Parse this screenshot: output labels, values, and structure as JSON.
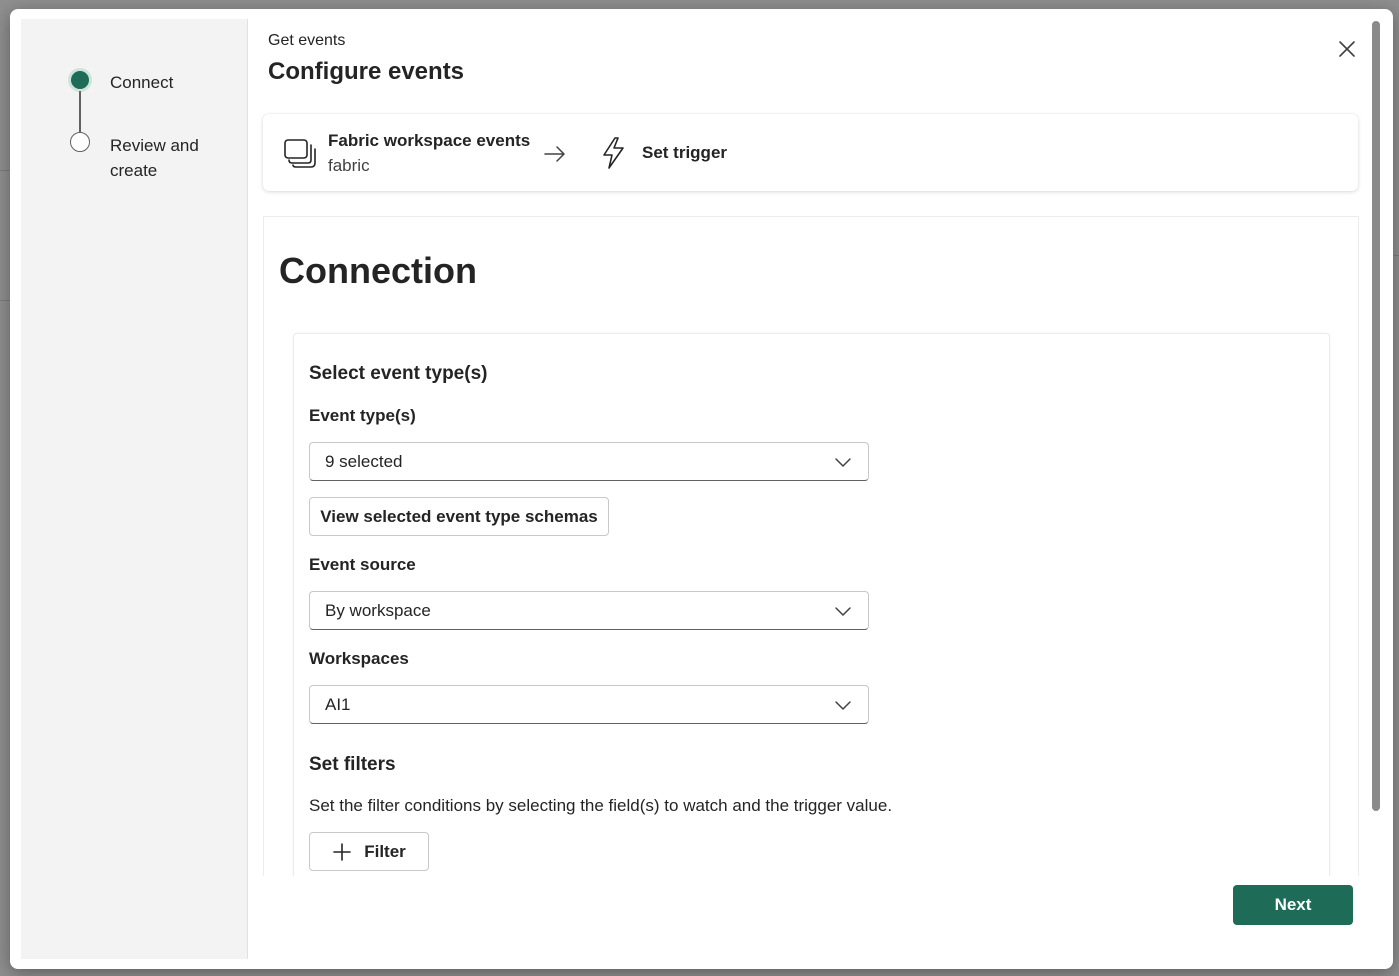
{
  "stepper": {
    "steps": [
      {
        "label": "Connect",
        "state": "active"
      },
      {
        "label": "Review and create",
        "label_line1": "Review and",
        "label_line2": "create",
        "state": "inactive"
      }
    ]
  },
  "header": {
    "subtitle": "Get events",
    "title": "Configure events"
  },
  "flow": {
    "source_title": "Fabric workspace events",
    "source_subtitle": "fabric",
    "target_title": "Set trigger"
  },
  "connection": {
    "title": "Connection",
    "section_title": "Select event type(s)",
    "event_types_label": "Event type(s)",
    "event_types_value": "9 selected",
    "view_schemas_button": "View selected event type schemas",
    "event_source_label": "Event source",
    "event_source_value": "By workspace",
    "workspaces_label": "Workspaces",
    "workspaces_value": "AI1",
    "filters_title": "Set filters",
    "filters_description": "Set the filter conditions by selecting the field(s) to watch and the trigger value.",
    "filter_button": "Filter"
  },
  "footer": {
    "next_button": "Next"
  },
  "colors": {
    "accent": "#1e6b58"
  },
  "icons": [
    "close-icon",
    "workspace-events-icon",
    "arrow-right-icon",
    "lightning-icon",
    "chevron-down-icon",
    "plus-icon"
  ]
}
